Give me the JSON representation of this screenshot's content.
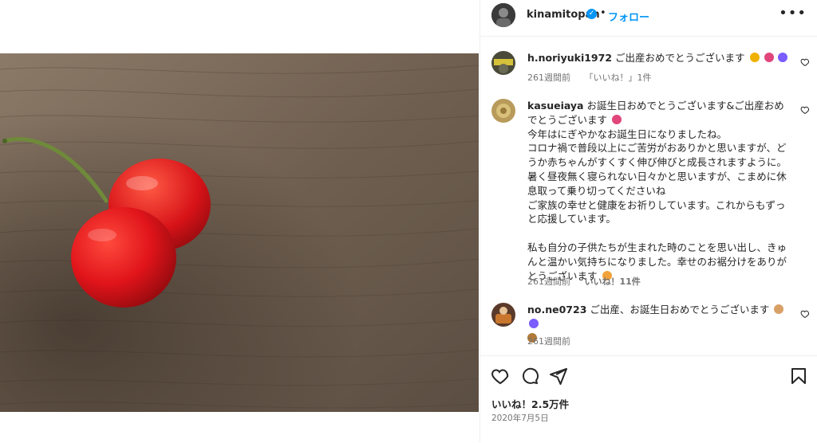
{
  "header": {
    "username": "kinamitopan",
    "separator": "•",
    "follow_label": "フォロー",
    "more_label": "•••"
  },
  "comments": [
    {
      "user": "h.noriyuki1972",
      "text": "ご出産おめでとうございます",
      "emojis": [
        "#f0b000",
        "#e0457b",
        "#7a5cff"
      ],
      "time": "261週間前",
      "likes": "「いいね！」1件"
    },
    {
      "user": "kasueiaya",
      "text": "お誕生日おめでとうございます&ご出産おめでとうございます",
      "emojis": [
        "#e0457b"
      ],
      "body": "今年はにぎやかなお誕生日になりましたね。\nコロナ禍で普段以上にご苦労がおありかと思いますが、どうか赤ちゃんがすくすく伸び伸びと成長されますように。\n暑く昼夜無く寝られない日々かと思いますが、こまめに休息取って乗り切ってくださいね\nご家族の幸せと健康をお祈りしています。これからもずっと応援しています。\n\n私も自分の子供たちが生まれた時のことを思い出し、きゅんと温かい気持ちになりました。幸せのお裾分けをありがとうございます",
      "end_emoji": "#f2a23a",
      "time": "261週間前",
      "likes": "いいね！11件"
    },
    {
      "user": "no.ne0723",
      "text": "ご出産、お誕生日おめでとうございます",
      "emojis": [
        "#d9a066",
        "#7a5cff",
        "#b07a3a"
      ],
      "time": "261週間前",
      "likes": ""
    }
  ],
  "post": {
    "likes_total": "いいね！2.5万件",
    "date": "2020年7月5日"
  },
  "colors": {
    "accent": "#0095f6",
    "text": "#262626",
    "muted": "#737373",
    "cherry": "#d8161b",
    "wood": "#7b6a5a"
  }
}
